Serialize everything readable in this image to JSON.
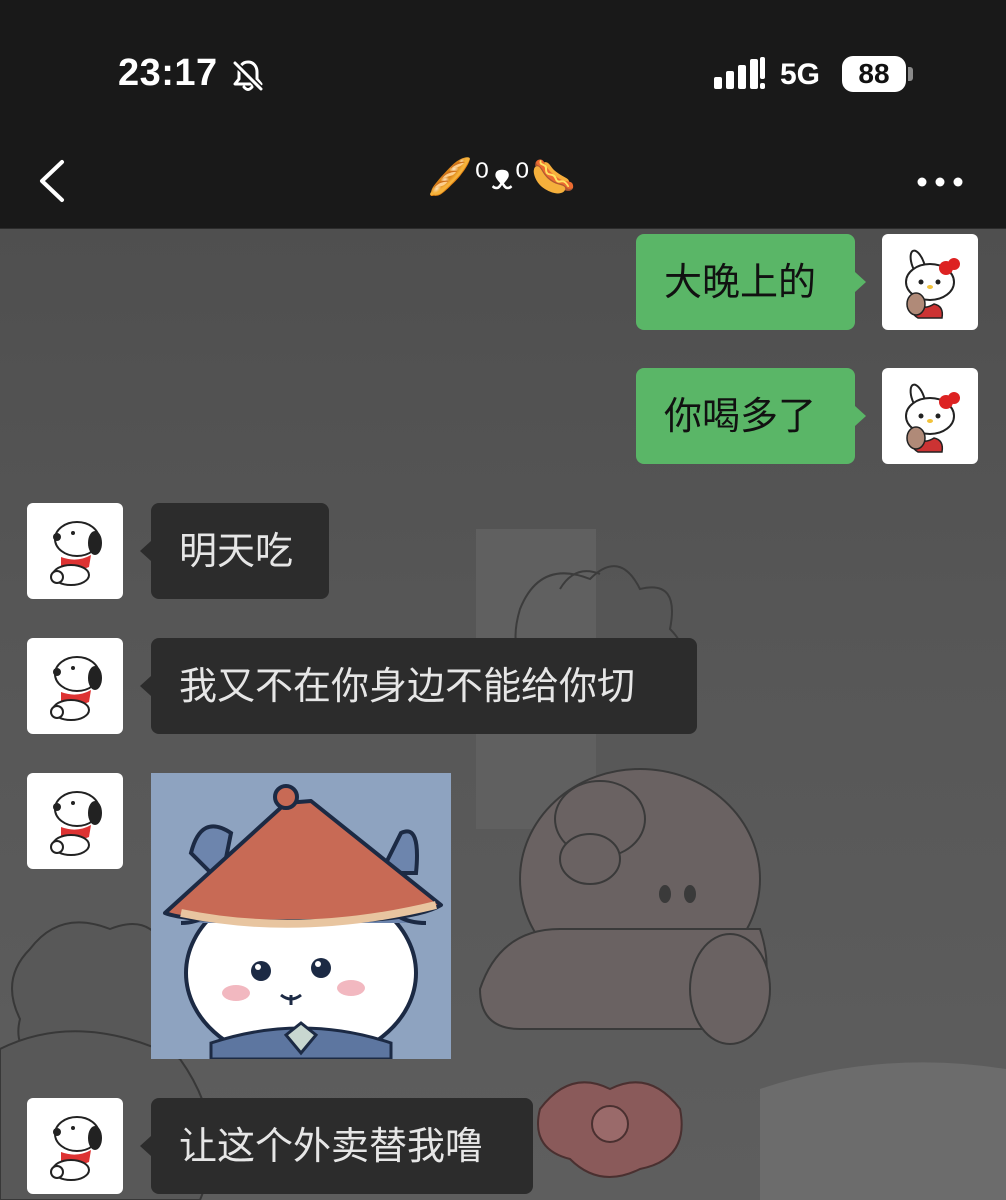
{
  "status_bar": {
    "time": "23:17",
    "network": "5G",
    "battery": "88",
    "icons": [
      "bell-muted-icon",
      "signal-icon"
    ]
  },
  "header": {
    "title": "🥖⁰ᴥ⁰🌭",
    "back_icon": "chevron-left-icon",
    "more_icon": "more-dots-icon"
  },
  "colors": {
    "outgoing_bubble": "#5ab667",
    "incoming_bubble": "#2c2c2c",
    "bar_background": "#191919"
  },
  "messages": [
    {
      "side": "right",
      "type": "text",
      "text": "大晚上的",
      "avatar": "hello-kitty-avatar"
    },
    {
      "side": "right",
      "type": "text",
      "text": "你喝多了",
      "avatar": "hello-kitty-avatar"
    },
    {
      "side": "left",
      "type": "text",
      "text": "明天吃",
      "avatar": "snoopy-avatar"
    },
    {
      "side": "left",
      "type": "text",
      "text": "我又不在你身边不能给你切",
      "avatar": "snoopy-avatar"
    },
    {
      "side": "left",
      "type": "sticker",
      "sticker": "cat-with-straw-hat-sticker",
      "avatar": "snoopy-avatar"
    },
    {
      "side": "left",
      "type": "text",
      "text": "让这个外卖替我噜",
      "avatar": "snoopy-avatar"
    }
  ]
}
